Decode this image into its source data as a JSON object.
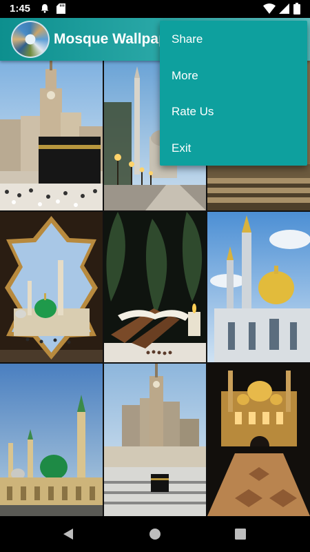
{
  "status_bar": {
    "time": "1:45",
    "icons": [
      "notification-bell-icon",
      "sd-card-icon",
      "wifi-icon",
      "cell-signal-icon",
      "battery-icon"
    ]
  },
  "app_bar": {
    "title": "Mosque Wallpapers",
    "color": "#1a9a99"
  },
  "overflow_menu": {
    "background": "#0ea09e",
    "items": [
      {
        "label": "Share"
      },
      {
        "label": "More"
      },
      {
        "label": "Rate Us"
      },
      {
        "label": "Exit"
      }
    ]
  },
  "wallpapers": [
    {
      "subject": "clock-tower-kaaba"
    },
    {
      "subject": "minaret-avenue"
    },
    {
      "subject": "stone-steps"
    },
    {
      "subject": "star-frame-green-dome"
    },
    {
      "subject": "quran-on-stand"
    },
    {
      "subject": "golden-dome-mosque"
    },
    {
      "subject": "green-dome-minarets-dusk"
    },
    {
      "subject": "clock-tower-crowd"
    },
    {
      "subject": "lit-mosque-night"
    }
  ],
  "nav_bar": {
    "icons": [
      "back-icon",
      "home-icon",
      "recents-icon"
    ]
  }
}
